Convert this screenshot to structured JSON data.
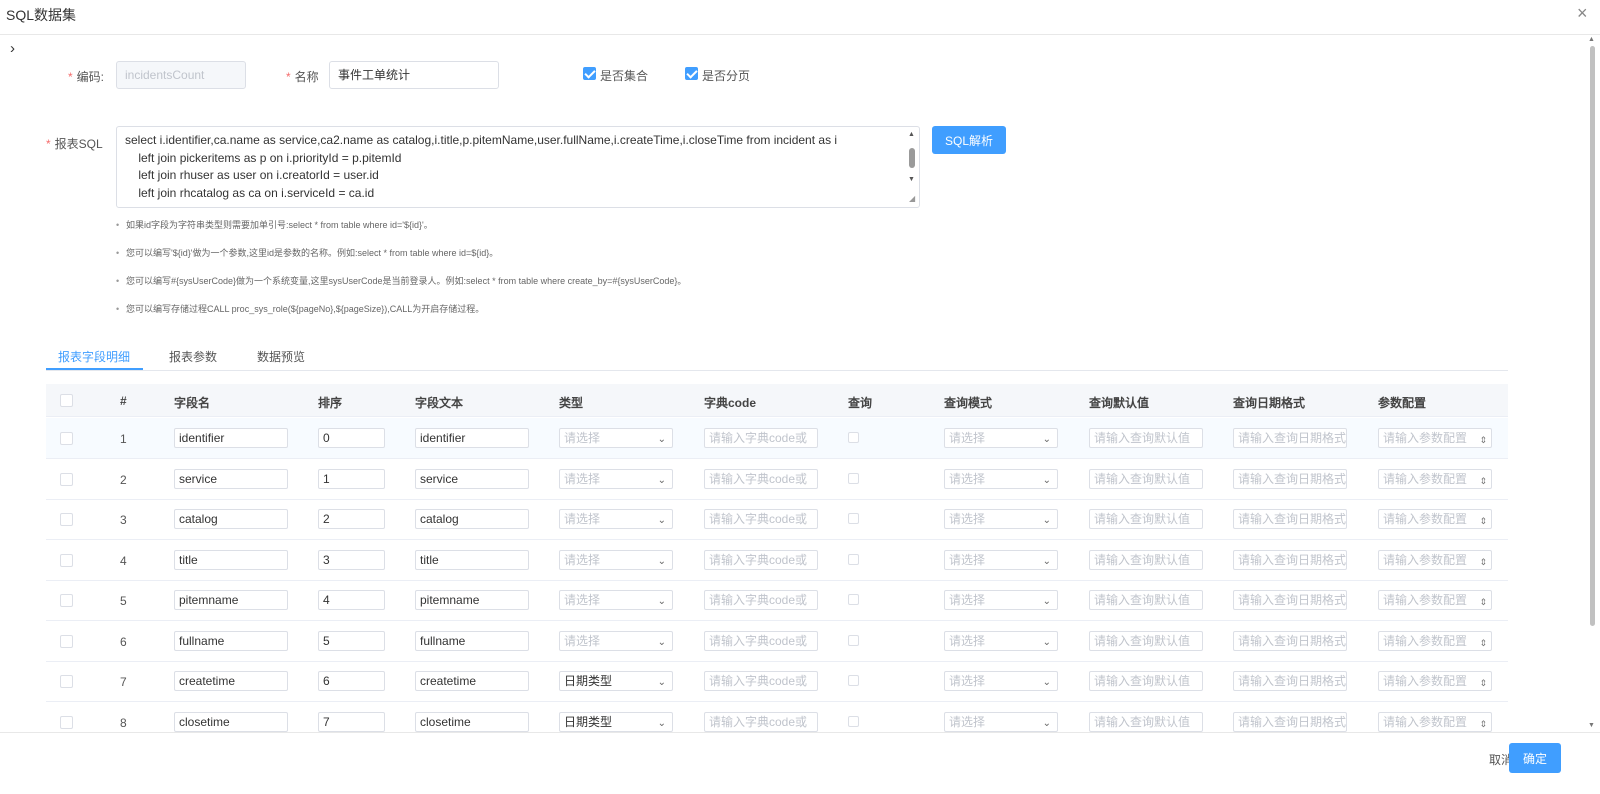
{
  "dialog": {
    "title": "SQL数据集",
    "close": "×",
    "collapse": "›"
  },
  "form": {
    "code_label": "编码:",
    "code_value": "incidentsCount",
    "name_label": "名称",
    "name_value": "事件工单统计",
    "is_collection_label": "是否集合",
    "is_paging_label": "是否分页",
    "sql_label": "报表SQL",
    "sql_lines": [
      "select i.identifier,ca.name as service,ca2.name as catalog,i.title,p.pitemName,user.fullName,i.createTime,i.closeTime from incident as i",
      "    left join pickeritems as p on i.priorityId = p.pitemId",
      "    left join rhuser as user on i.creatorId = user.id",
      "    left join rhcatalog as ca on i.serviceId = ca.id"
    ],
    "parse_button": "SQL解析"
  },
  "tips": [
    "如果id字段为字符串类型则需要加单引号:select * from table where id='${id}'。",
    "您可以编写'${id}'做为一个参数,这里id是参数的名称。例如:select * from table where id=${id}。",
    "您可以编写#{sysUserCode}做为一个系统变量,这里sysUserCode是当前登录人。例如:select * from table where create_by=#{sysUserCode}。",
    "您可以编写存储过程CALL proc_sys_role(${pageNo},${pageSize}),CALL为开启存储过程。"
  ],
  "tabs": [
    "报表字段明细",
    "报表参数",
    "数据预览"
  ],
  "table": {
    "headers": [
      "#",
      "字段名",
      "排序",
      "字段文本",
      "类型",
      "字典code",
      "查询",
      "查询模式",
      "查询默认值",
      "查询日期格式",
      "参数配置"
    ],
    "placeholders": {
      "type": "请选择",
      "dict": "请输入字典code或",
      "mode": "请选择",
      "default": "请输入查询默认值",
      "date_format": "请输入查询日期格式",
      "param": "请输入参数配置"
    },
    "rows": [
      {
        "num": "1",
        "field": "identifier",
        "order": "0",
        "text": "identifier",
        "type": ""
      },
      {
        "num": "2",
        "field": "service",
        "order": "1",
        "text": "service",
        "type": ""
      },
      {
        "num": "3",
        "field": "catalog",
        "order": "2",
        "text": "catalog",
        "type": ""
      },
      {
        "num": "4",
        "field": "title",
        "order": "3",
        "text": "title",
        "type": ""
      },
      {
        "num": "5",
        "field": "pitemname",
        "order": "4",
        "text": "pitemname",
        "type": ""
      },
      {
        "num": "6",
        "field": "fullname",
        "order": "5",
        "text": "fullname",
        "type": ""
      },
      {
        "num": "7",
        "field": "createtime",
        "order": "6",
        "text": "createtime",
        "type": "日期类型"
      },
      {
        "num": "8",
        "field": "closetime",
        "order": "7",
        "text": "closetime",
        "type": "日期类型"
      }
    ]
  },
  "footer": {
    "cancel": "取消",
    "confirm": "确定"
  },
  "colors": {
    "primary": "#409eff",
    "required": "#f56c6c"
  }
}
